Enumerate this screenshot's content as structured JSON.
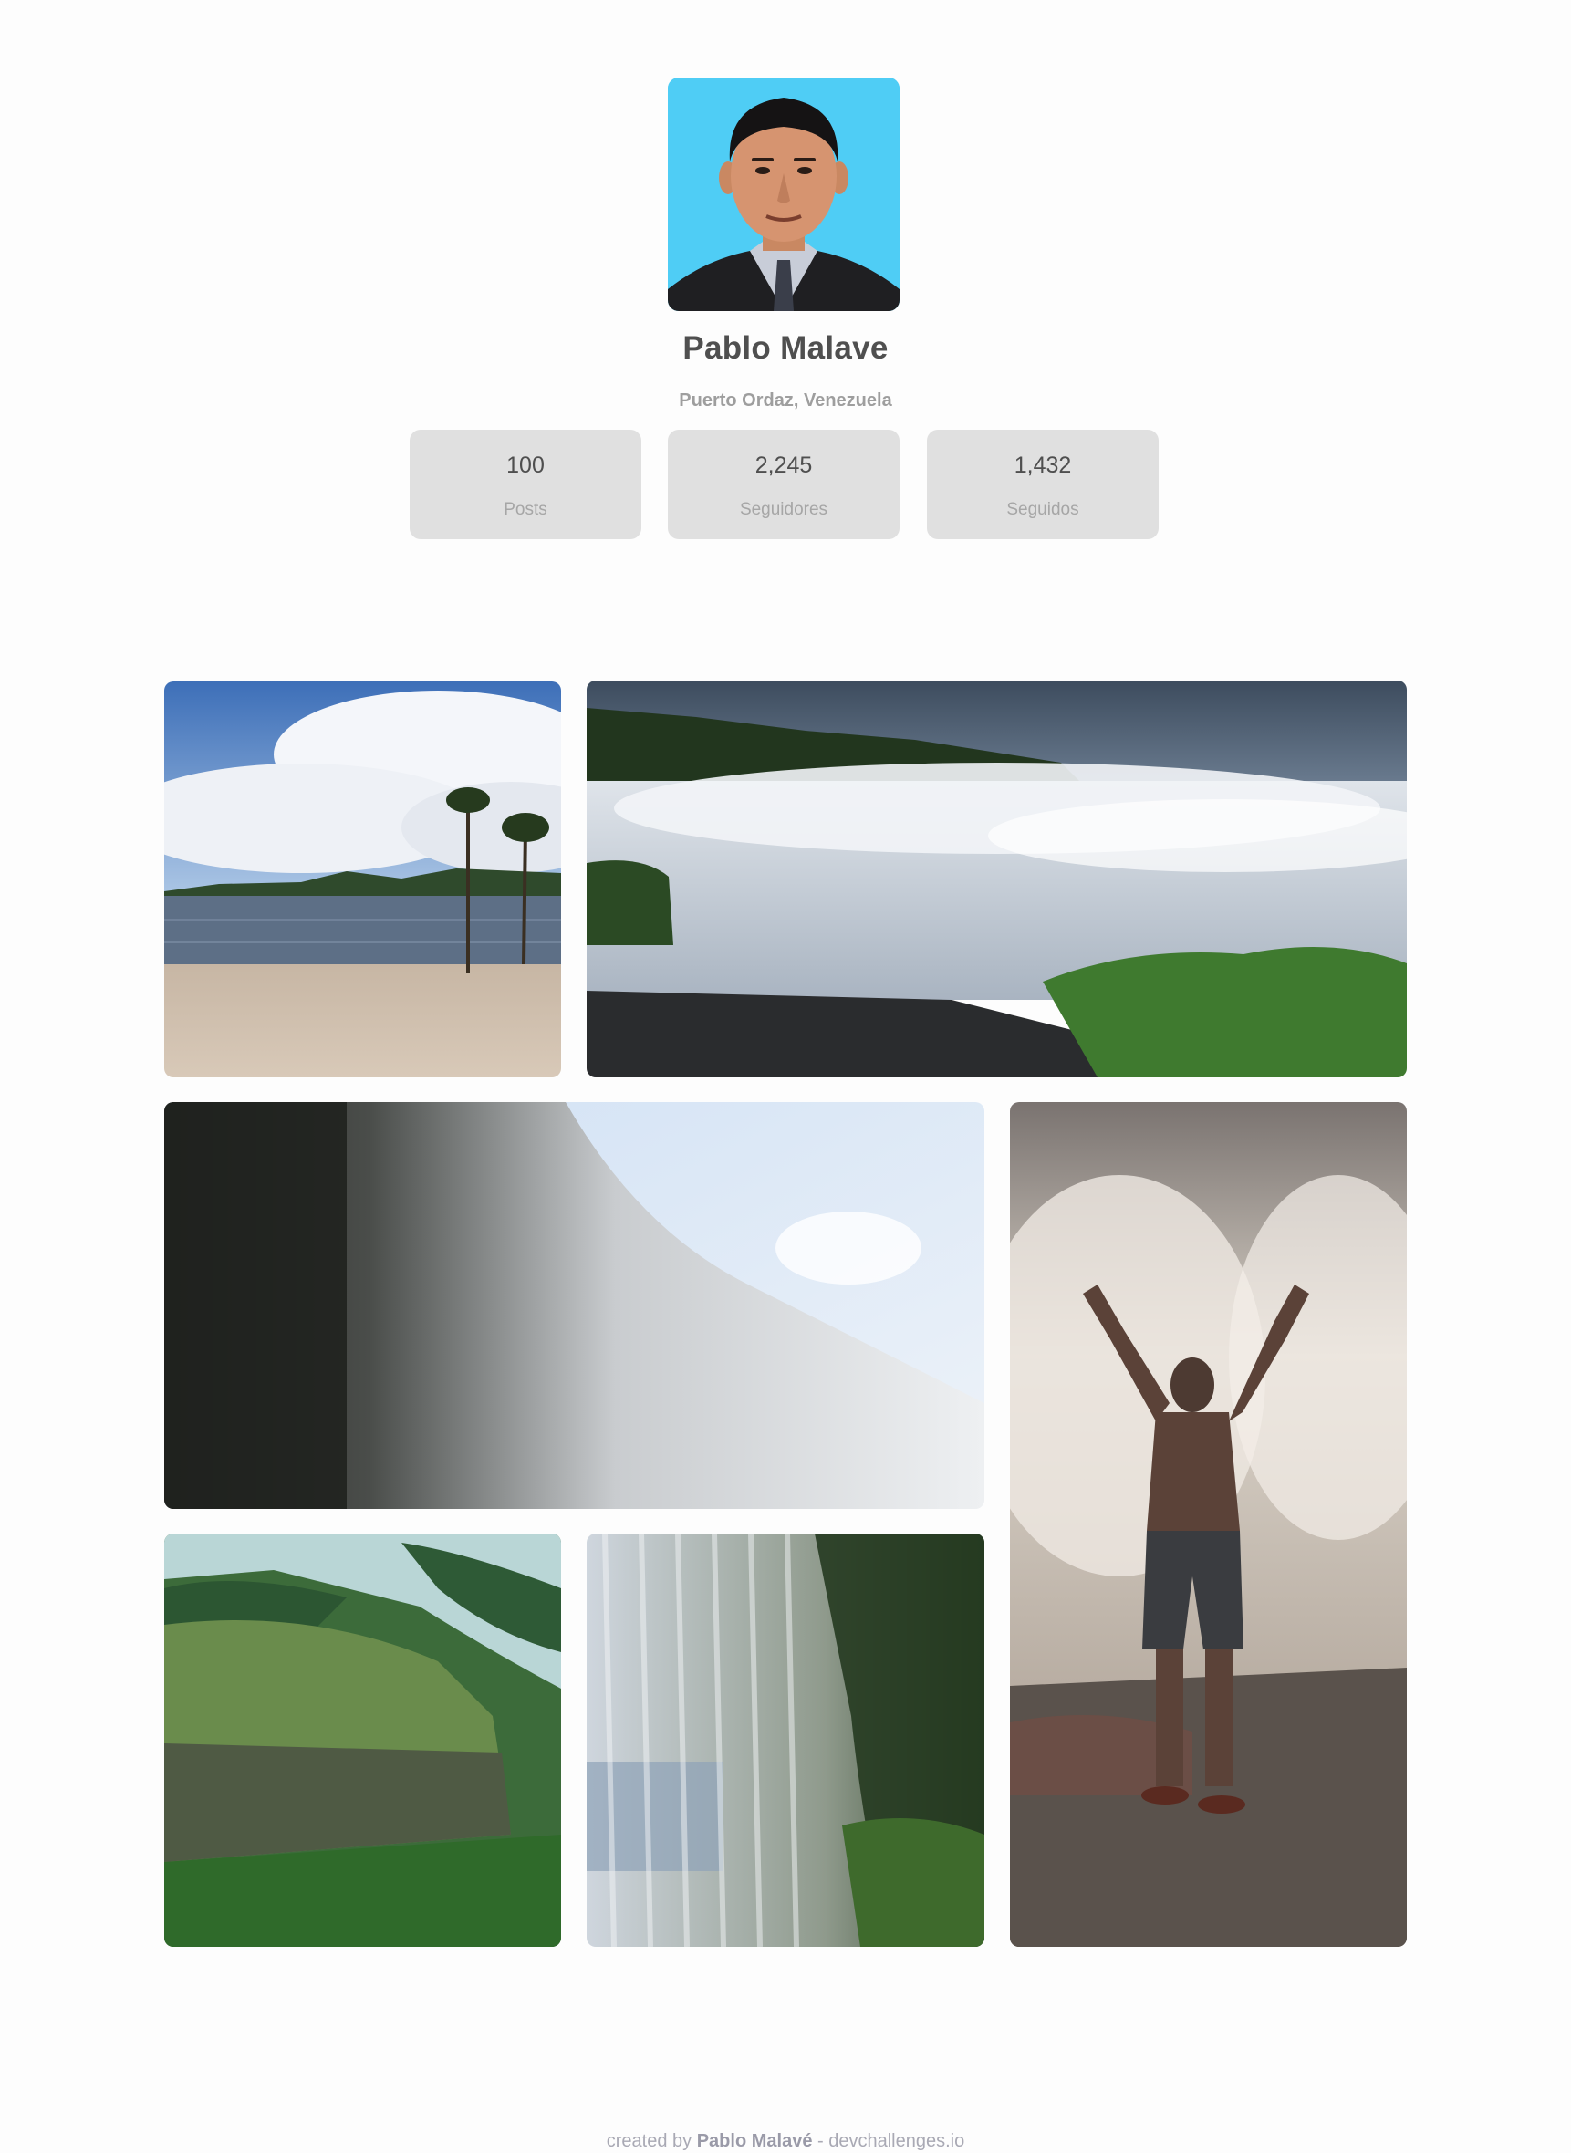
{
  "profile": {
    "name": "Pablo Malave",
    "location": "Puerto Ordaz, Venezuela",
    "avatar_alt": "profile-photo"
  },
  "stats": [
    {
      "value": "100",
      "label": "Posts"
    },
    {
      "value": "2,245",
      "label": "Seguidores"
    },
    {
      "value": "1,432",
      "label": "Seguidos"
    }
  ],
  "gallery": [
    {
      "subject": "beach-lagoon-palms"
    },
    {
      "subject": "wide-waterfall-river"
    },
    {
      "subject": "waterfall-curtain-sky"
    },
    {
      "subject": "person-at-waterfall"
    },
    {
      "subject": "aerial-tepui-river"
    },
    {
      "subject": "behind-waterfall"
    }
  ],
  "footer": {
    "prefix": "created by",
    "author": "Pablo Malavé",
    "suffix": "- devchallenges.io"
  },
  "colors": {
    "background": "#fdfdfd",
    "stat_card": "#e0e0e0",
    "text_primary": "#4f4f4f",
    "text_muted": "#9e9e9e",
    "avatar_bg": "#4fcdf5"
  }
}
